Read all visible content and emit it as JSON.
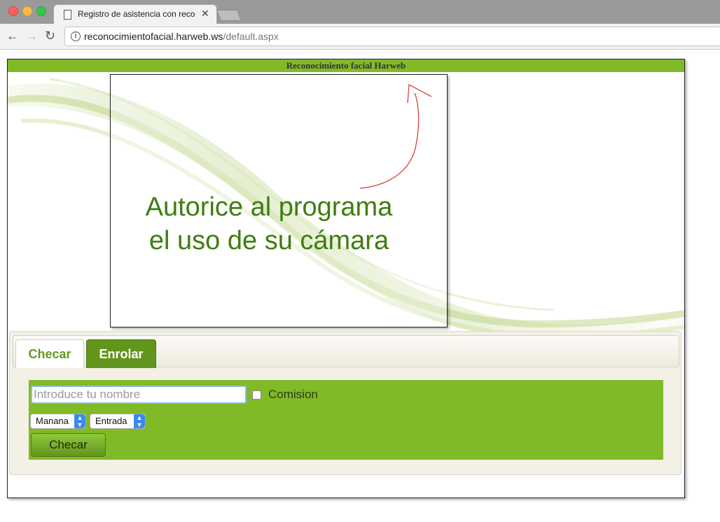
{
  "browser": {
    "tab_title": "Registro de asistencia con reco",
    "url_host": "reconocimientofacial.harweb.ws",
    "url_path": "/default.aspx",
    "tab_close_glyph": "✕",
    "back_glyph": "←",
    "forward_glyph": "→",
    "reload_glyph": "↻",
    "info_glyph": "i"
  },
  "app": {
    "header_title": "Reconocimiento facial Harweb",
    "camera_message_line1": "Autorice al programa",
    "camera_message_line2": "el uso de su cámara",
    "accent_color": "#80ba27",
    "dark_accent_color": "#62951c",
    "message_color": "#3f7d10"
  },
  "tabs": [
    {
      "label": "Checar",
      "active": true
    },
    {
      "label": "Enrolar",
      "active": false
    }
  ],
  "form": {
    "name_placeholder": "Introduce tu nombre",
    "name_value": "",
    "comision_label": "Comision",
    "comision_checked": false,
    "turno_selected": "Manana",
    "tipo_selected": "Entrada",
    "submit_label": "Checar"
  },
  "icons": {
    "page": "page-icon",
    "info": "info-icon",
    "select_arrow": "up-down-chevron-icon"
  }
}
